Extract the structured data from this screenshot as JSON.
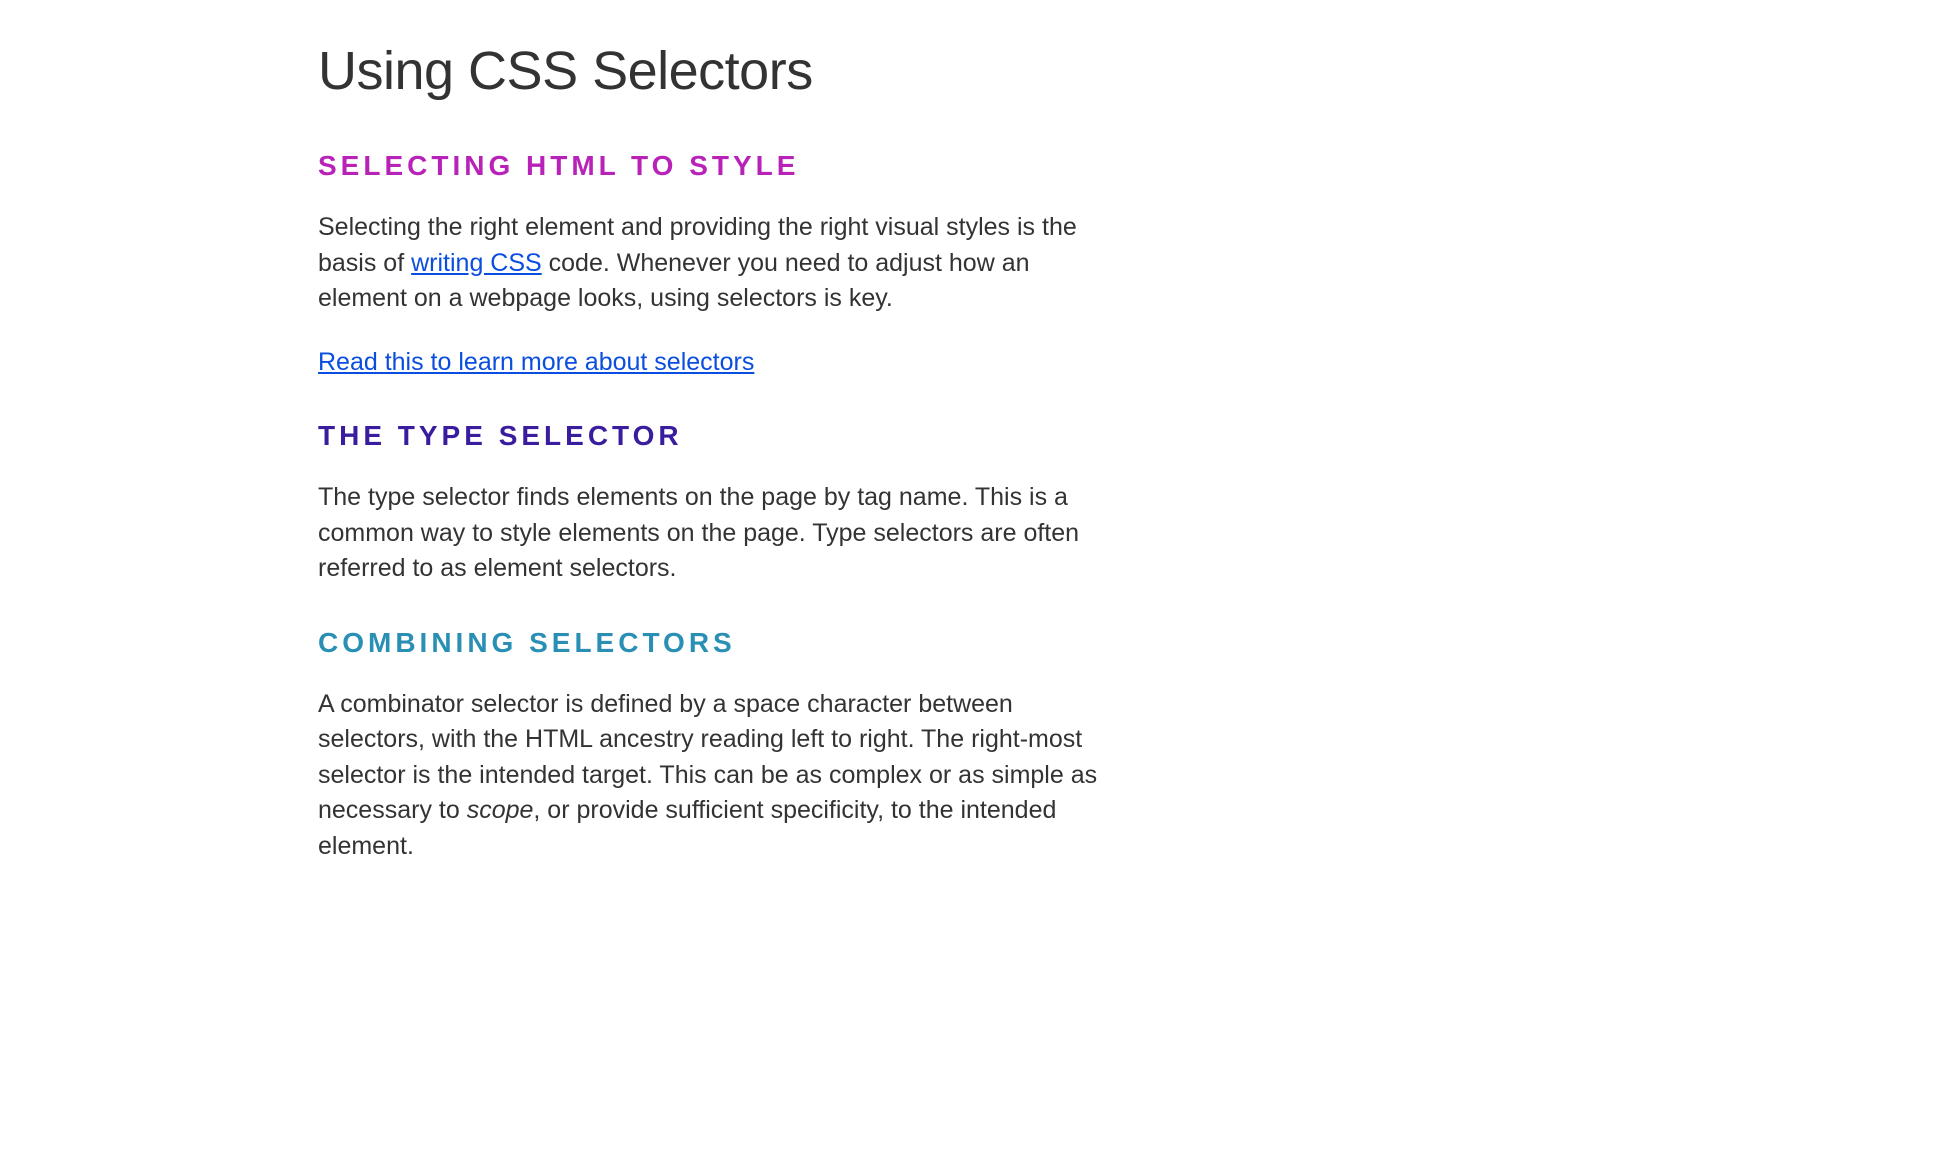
{
  "title": "Using CSS Selectors",
  "sections": [
    {
      "heading": "Selecting HTML to Style",
      "para1_before": "Selecting the right element and providing the right visual styles is the basis of ",
      "para1_link": "writing CSS",
      "para1_after": " code. Whenever you need to adjust how an element on a webpage looks, using selectors is key.",
      "read_more_link": "Read this to learn more about selectors"
    },
    {
      "heading": "The Type Selector",
      "para": "The type selector finds elements on the page by tag name. This is a common way to style elements on the page. Type selectors are often referred to as element selectors."
    },
    {
      "heading": "Combining Selectors",
      "para_before": "A combinator selector is defined by a space character between selectors, with the HTML ancestry reading left to right. The right-most selector is the intended target. This can be as complex or as simple as necessary to ",
      "para_em": "scope",
      "para_after": ", or provide sufficient specificity, to the intended element."
    }
  ]
}
